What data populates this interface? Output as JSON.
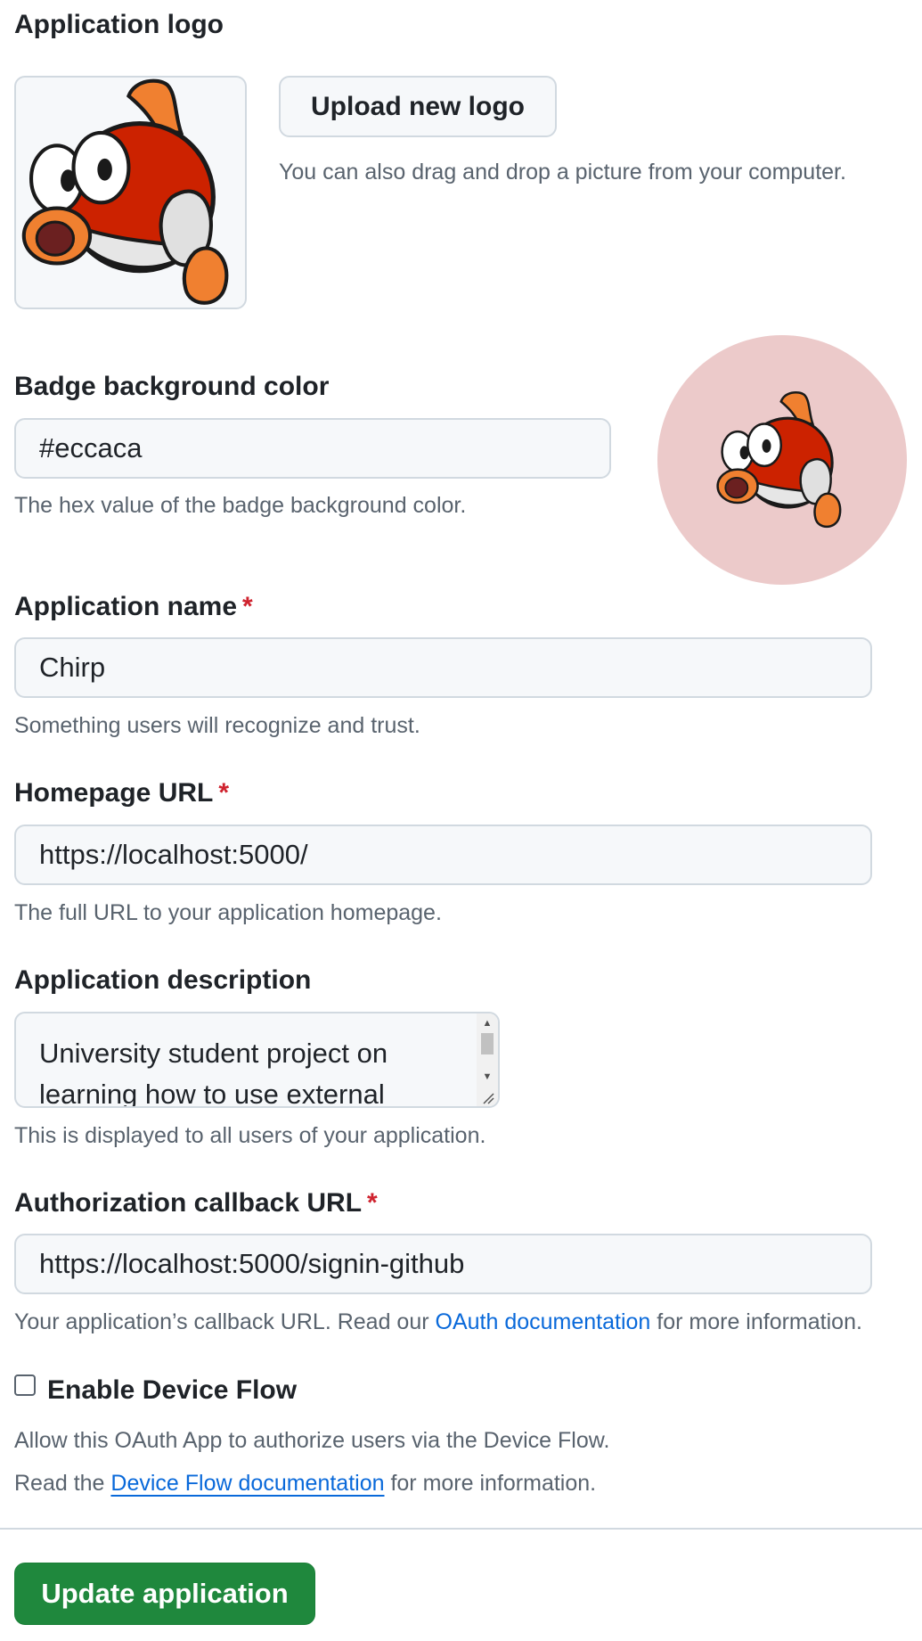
{
  "logo": {
    "label": "Application logo",
    "upload_button": "Upload new logo",
    "drag_hint": "You can also drag and drop a picture from your computer."
  },
  "badge": {
    "label": "Badge background color",
    "value": "#eccaca",
    "hint": "The hex value of the badge background color.",
    "color": "#eccaca"
  },
  "app_name": {
    "label": "Application name",
    "required_mark": "*",
    "value": "Chirp",
    "hint": "Something users will recognize and trust."
  },
  "homepage": {
    "label": "Homepage URL",
    "required_mark": "*",
    "value": "https://localhost:5000/",
    "hint": "The full URL to your application homepage."
  },
  "description": {
    "label": "Application description",
    "value": "University student project on learning how to use external",
    "hint": "This is displayed to all users of your application."
  },
  "callback": {
    "label": "Authorization callback URL",
    "required_mark": "*",
    "value": "https://localhost:5000/signin-github",
    "hint_prefix": "Your application’s callback URL. Read our ",
    "hint_link": "OAuth documentation",
    "hint_suffix": " for more information."
  },
  "device_flow": {
    "label": "Enable Device Flow",
    "checked": false,
    "hint_line1": "Allow this OAuth App to authorize users via the Device Flow.",
    "hint_prefix": "Read the ",
    "hint_link": "Device Flow documentation",
    "hint_suffix": " for more information."
  },
  "submit": {
    "label": "Update application"
  },
  "icons": {
    "logo_image": "fish-mascot-icon",
    "scroll_up": "scroll-up-arrow-icon",
    "scroll_down": "scroll-down-arrow-icon",
    "resize": "resize-grip-icon"
  }
}
